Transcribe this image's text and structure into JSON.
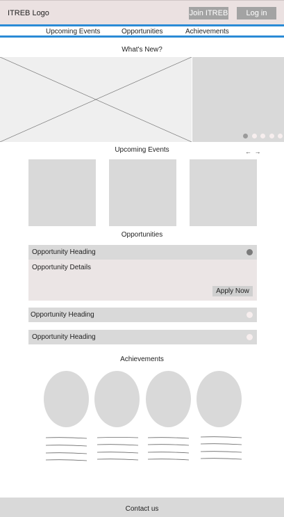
{
  "header": {
    "logo": "ITREB Logo",
    "join_label": "Join ITREB",
    "login_label": "Log in"
  },
  "nav": {
    "items": [
      "Upcoming Events",
      "Opportunities",
      "Achievements"
    ]
  },
  "whats_new": {
    "title": "What's New?",
    "carousel_dots": 5,
    "active_dot": 0
  },
  "events": {
    "title": "Upcoming Events",
    "arrows": "← →",
    "card_count": 3
  },
  "opportunities": {
    "title": "Opportunities",
    "items": [
      {
        "heading": "Opportunity Heading",
        "details": "Opportunity Details",
        "apply_label": "Apply Now",
        "expanded": true
      },
      {
        "heading": "Opportunity Heading",
        "expanded": false
      },
      {
        "heading": "Opportunity Heading",
        "expanded": false
      }
    ]
  },
  "achievements": {
    "title": "Achievements",
    "item_count": 4
  },
  "footer": {
    "contact_label": "Contact us"
  },
  "colors": {
    "header_bg": "#ebe1e1",
    "nav_border": "#2a8bd6",
    "placeholder_gray": "#d9d9d9",
    "button_gray": "#a3a3a3"
  }
}
